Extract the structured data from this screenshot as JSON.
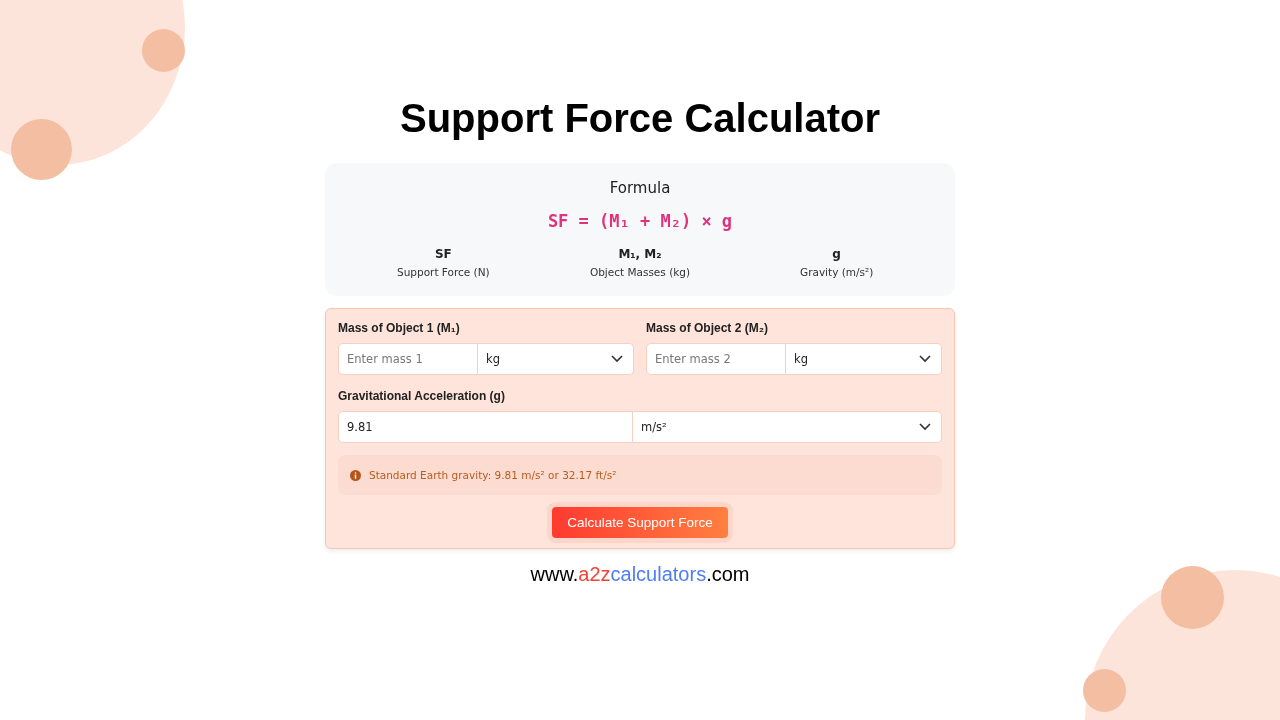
{
  "title": "Support Force Calculator",
  "formula": {
    "heading": "Formula",
    "expression": "SF = (M₁ + M₂) × g",
    "variables": [
      {
        "symbol": "SF",
        "meaning": "Support Force (N)"
      },
      {
        "symbol": "M₁, M₂",
        "meaning": "Object Masses (kg)"
      },
      {
        "symbol": "g",
        "meaning": "Gravity (m/s²)"
      }
    ]
  },
  "form": {
    "mass_fields": [
      {
        "label": "Mass of Object 1 (M₁)",
        "placeholder": "Enter mass 1",
        "unit": "kg"
      },
      {
        "label": "Mass of Object 2 (M₂)",
        "placeholder": "Enter mass 2",
        "unit": "kg"
      }
    ],
    "gravity": {
      "label": "Gravitational Acceleration (g)",
      "value": "9.81",
      "unit": "m/s²"
    },
    "note": "Standard Earth gravity: 9.81 m/s² or 32.17 ft/s²",
    "button": "Calculate Support Force"
  },
  "footer": [
    {
      "text": "www.",
      "color": "#000000"
    },
    {
      "text": "a2z",
      "color": "#f04438"
    },
    {
      "text": "calculators",
      "color": "#4f7cf7"
    },
    {
      "text": ".com",
      "color": "#000000"
    }
  ]
}
